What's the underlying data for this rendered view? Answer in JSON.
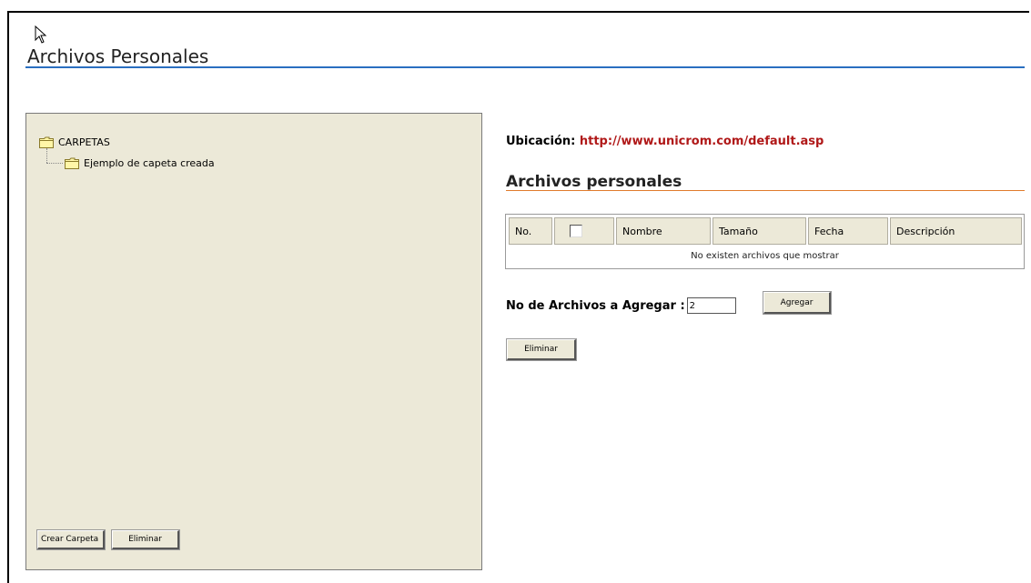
{
  "page": {
    "title": "Archivos Personales"
  },
  "folder_tree": {
    "root": "CARPETAS",
    "children": [
      "Ejemplo de capeta creada"
    ],
    "buttons": {
      "create": "Crear Carpeta",
      "delete": "Eliminar"
    }
  },
  "location": {
    "label": "Ubicación:",
    "url": "http://www.unicrom.com/default.asp"
  },
  "files": {
    "title": "Archivos personales",
    "columns": [
      "No.",
      "",
      "Nombre",
      "Tamaño",
      "Fecha",
      "Descripción"
    ],
    "empty_message": "No existen archivos que mostrar"
  },
  "add_files": {
    "label": "No de Archivos a Agregar :",
    "value": "2",
    "button": "Agregar"
  },
  "delete_button": "Eliminar",
  "colors": {
    "title_rule": "#2a6fc0",
    "section_rule": "#e07b2c",
    "url": "#b01818",
    "panel_bg": "#ece9d8"
  }
}
